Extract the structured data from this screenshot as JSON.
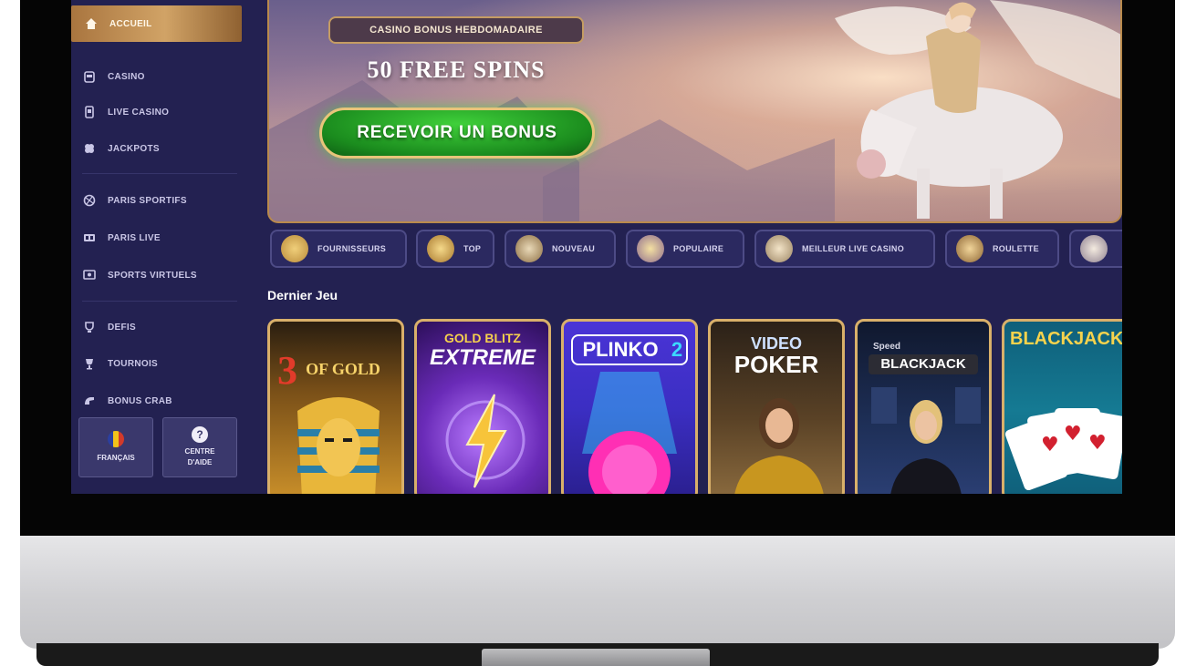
{
  "sidebar": {
    "active": {
      "label": "ACCUEIL",
      "icon": "home-icon"
    },
    "items": [
      {
        "label": "CASINO",
        "icon": "slot-machine-icon"
      },
      {
        "label": "LIVE CASINO",
        "icon": "phone-icon"
      },
      {
        "label": "JACKPOTS",
        "icon": "clover-icon"
      },
      {
        "label": "PARIS SPORTIFS",
        "icon": "ball-icon"
      },
      {
        "label": "PARIS LIVE",
        "icon": "scoreboard-icon"
      },
      {
        "label": "SPORTS VIRTUELS",
        "icon": "virtual-screen-icon"
      },
      {
        "label": "DEFIS",
        "icon": "trophy-icon"
      },
      {
        "label": "TOURNOIS",
        "icon": "cup-icon"
      },
      {
        "label": "BONUS CRAB",
        "icon": "crab-icon"
      }
    ],
    "language_button": {
      "label": "FRANÇAIS",
      "icon": "flag-icon"
    },
    "help_button": {
      "label_line1": "CENTRE",
      "label_line2": "D'AIDE",
      "icon": "question-icon",
      "glyph": "?"
    }
  },
  "banner": {
    "tag": "CASINO BONUS HEBDOMADAIRE",
    "title": "50 FREE SPINS",
    "cta": "RECEVOIR UN BONUS"
  },
  "categories": [
    {
      "label": "FOURNISSEURS",
      "icon": "scroll-icon"
    },
    {
      "label": "TOP",
      "icon": "wings-icon"
    },
    {
      "label": "NOUVEAU",
      "icon": "trophy-icon"
    },
    {
      "label": "POPULAIRE",
      "icon": "crown-icon"
    },
    {
      "label": "MEILLEUR LIVE CASINO",
      "icon": "chips-icon"
    },
    {
      "label": "ROULETTE",
      "icon": "roulette-icon"
    },
    {
      "label": "",
      "icon": "dice-icon"
    }
  ],
  "section": {
    "title": "Dernier Jeu"
  },
  "games": [
    {
      "title_line1": "3",
      "title_line2": "OF GOLD",
      "theme": "pharaoh"
    },
    {
      "title_line1": "GOLD BLITZ",
      "title_line2": "EXTREME",
      "theme": "lightning"
    },
    {
      "title_line1": "PLINKO",
      "title_line2": "2",
      "theme": "plinko"
    },
    {
      "title_line1": "VIDEO",
      "title_line2": "POKER",
      "theme": "poker"
    },
    {
      "title_line1": "Speed",
      "title_line2": "BLACKJACK",
      "theme": "blackjack-live"
    },
    {
      "title_line1": "BLACKJACK",
      "title_line2": "",
      "theme": "blackjack-cards"
    }
  ],
  "colors": {
    "screen_bg": "#232151",
    "accent_gold": "#d1a366",
    "cta_green": "#1b8c1e",
    "pill_border": "#4d4b86"
  }
}
